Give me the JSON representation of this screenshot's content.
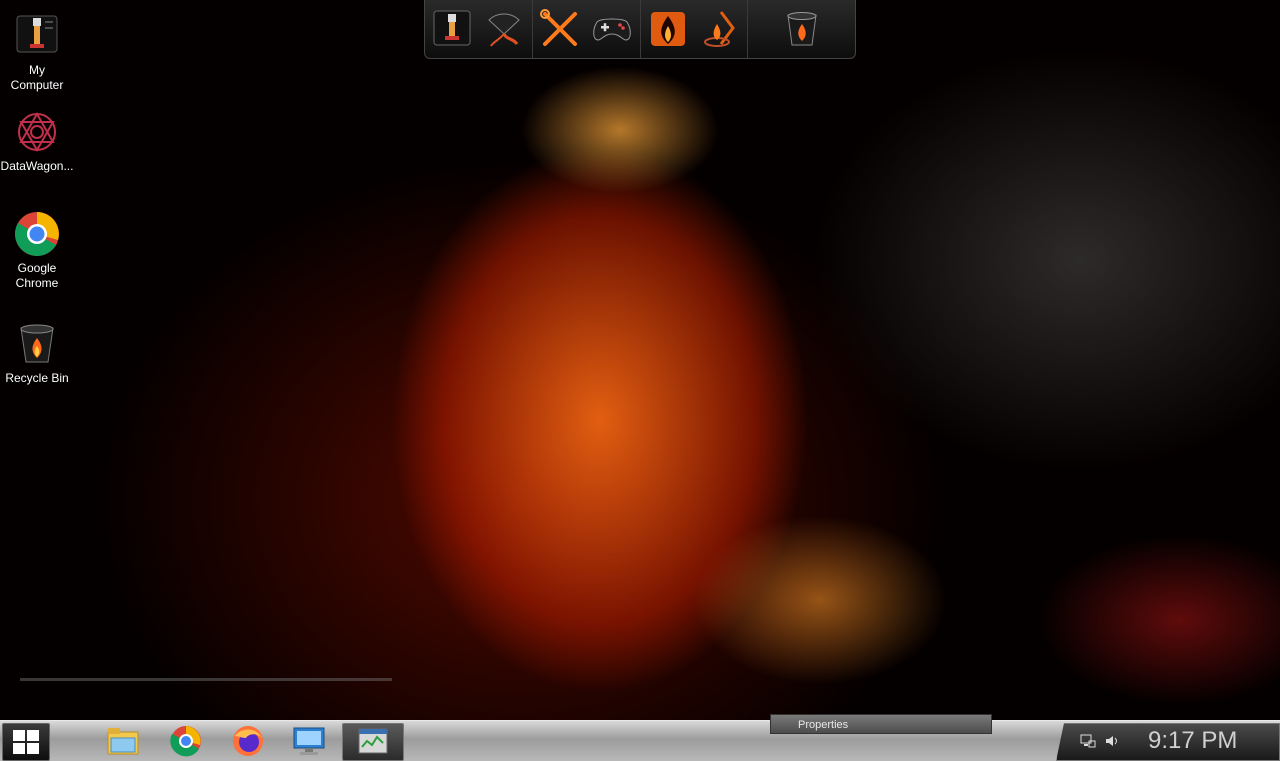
{
  "desktop": {
    "icons": [
      {
        "label": "My\nComputer",
        "line1": "My",
        "line2": "Computer",
        "icon": "my-computer-icon"
      },
      {
        "label": "DataWagon...",
        "line1": "DataWagon...",
        "line2": "",
        "icon": "datawagon-icon"
      },
      {
        "label": "Google Chrome",
        "line1": "Google",
        "line2": "Chrome",
        "icon": "chrome-icon"
      },
      {
        "label": "Recycle Bin",
        "line1": "Recycle Bin",
        "line2": "",
        "icon": "recycle-bin-icon"
      }
    ]
  },
  "dock": {
    "items": [
      "computer-icon",
      "network-icon",
      "tools-icon",
      "gamepad-icon",
      "fire-app-icon",
      "flame-lamp-icon",
      "recycle-bin-icon"
    ]
  },
  "taskbar": {
    "pinned": [
      "file-explorer-icon",
      "chrome-icon",
      "firefox-icon",
      "remote-desktop-icon",
      "task-manager-icon"
    ],
    "tooltip": "Properties",
    "clock": "9:17 PM",
    "accent": "#ff7a1a"
  }
}
